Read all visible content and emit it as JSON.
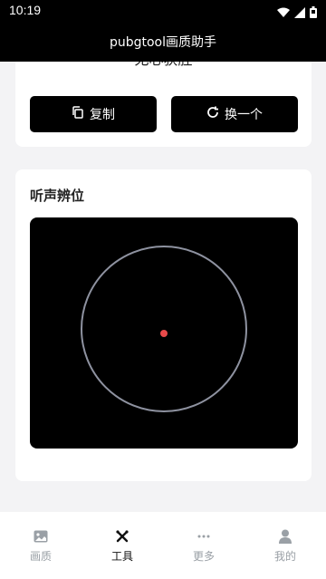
{
  "status_bar": {
    "time": "10:19"
  },
  "app_bar": {
    "title": "pubgtool画质助手"
  },
  "top_card": {
    "cut_text": "无心获胜",
    "copy_label": "复制",
    "change_label": "换一个"
  },
  "listen_card": {
    "title": "听声辨位"
  },
  "colors": {
    "accent": "#000000",
    "dot": "#e84a4a",
    "ring": "#8e92a0"
  },
  "tabs": [
    {
      "label": "画质",
      "icon": "image-icon",
      "active": false
    },
    {
      "label": "工具",
      "icon": "tools-icon",
      "active": true
    },
    {
      "label": "更多",
      "icon": "more-icon",
      "active": false
    },
    {
      "label": "我的",
      "icon": "user-icon",
      "active": false
    }
  ]
}
